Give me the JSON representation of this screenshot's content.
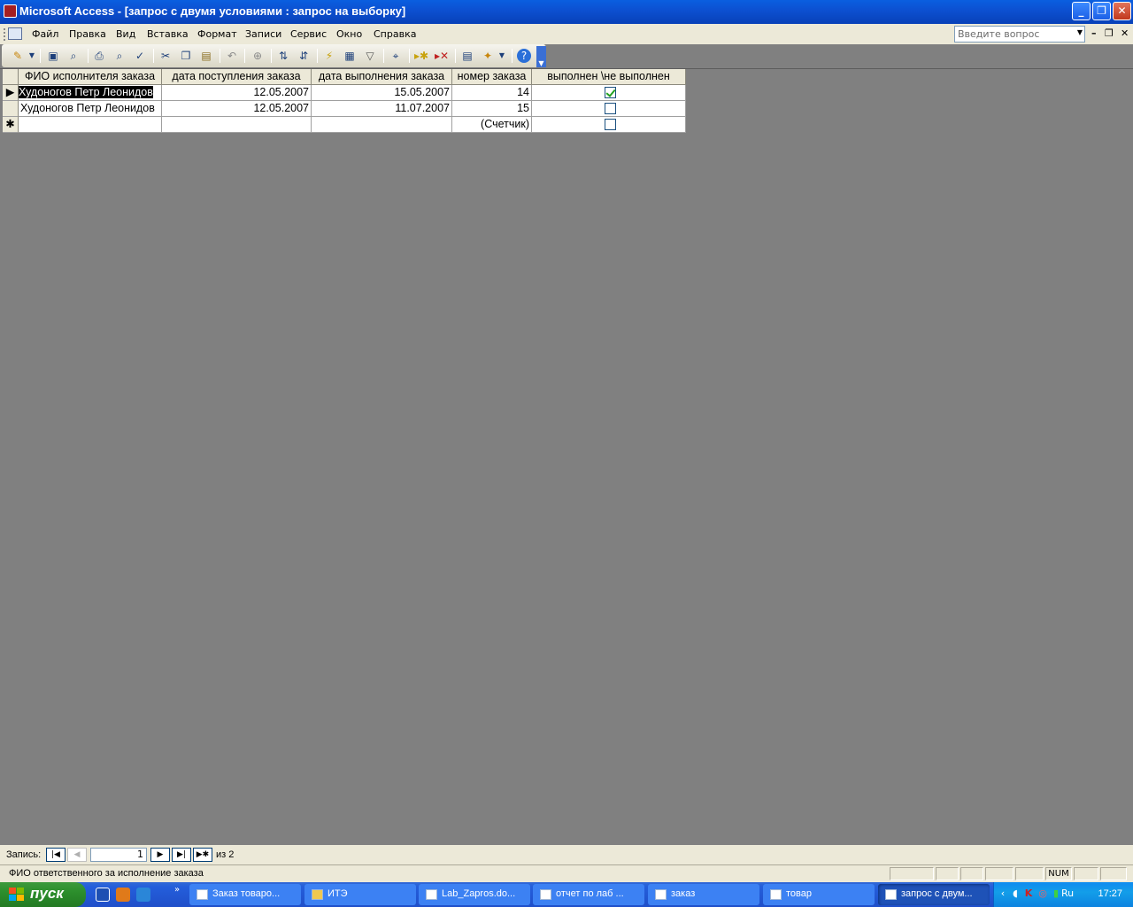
{
  "window": {
    "title": "Microsoft Access - [запрос с двумя условиями : запрос на выборку]",
    "minimize": "_",
    "restore": "❐",
    "close": "✕"
  },
  "menu": {
    "items": [
      "Файл",
      "Правка",
      "Вид",
      "Вставка",
      "Формат",
      "Записи",
      "Сервис",
      "Окно",
      "Справка"
    ],
    "help_placeholder": "Введите вопрос",
    "mdi_minimize": "–",
    "mdi_restore": "❐",
    "mdi_close": "✕"
  },
  "toolbar": {
    "icons": [
      "view-icon",
      "save-icon",
      "search-file-icon",
      "print-icon",
      "print-preview-icon",
      "spelling-icon",
      "cut-icon",
      "copy-icon",
      "paste-icon",
      "undo-icon",
      "hyperlink-icon",
      "sort-ascending-icon",
      "sort-descending-icon",
      "filter-by-selection-icon",
      "filter-by-form-icon",
      "apply-filter-icon",
      "find-icon",
      "new-record-icon",
      "delete-record-icon",
      "database-window-icon",
      "new-object-icon",
      "help-icon"
    ]
  },
  "datasheet": {
    "columns": [
      "ФИО  исполнителя заказа",
      "дата  поступления заказа",
      "дата выполнения заказа",
      "номер заказа",
      "выполнен \\не выполнен"
    ],
    "rows": [
      {
        "fio": "Худоногов Петр Леонидов",
        "date_in": "12.05.2007",
        "date_done": "15.05.2007",
        "number": "14",
        "done": true
      },
      {
        "fio": "Худоногов Петр Леонидов",
        "date_in": "12.05.2007",
        "date_done": "11.07.2007",
        "number": "15",
        "done": false
      }
    ],
    "new_row": {
      "marker": "✱",
      "number": "(Счетчик)",
      "done": false
    },
    "current_marker": "▶"
  },
  "navigator": {
    "label": "Запись:",
    "current": "1",
    "of_text": "из  2",
    "first": "|◀",
    "prev": "◀",
    "next": "▶",
    "last": "▶|",
    "new": "▶✱"
  },
  "status": {
    "text": "ФИО ответственного за исполнение заказа",
    "num": "NUM"
  },
  "taskbar": {
    "start": "пуск",
    "tasks": [
      "Заказ товаро...",
      "ИТЭ",
      "Lab_Zapros.do...",
      "отчет по лаб ...",
      "заказ",
      "товар",
      "запрос с двум..."
    ],
    "lang": "Ru",
    "clock": "17:27"
  }
}
